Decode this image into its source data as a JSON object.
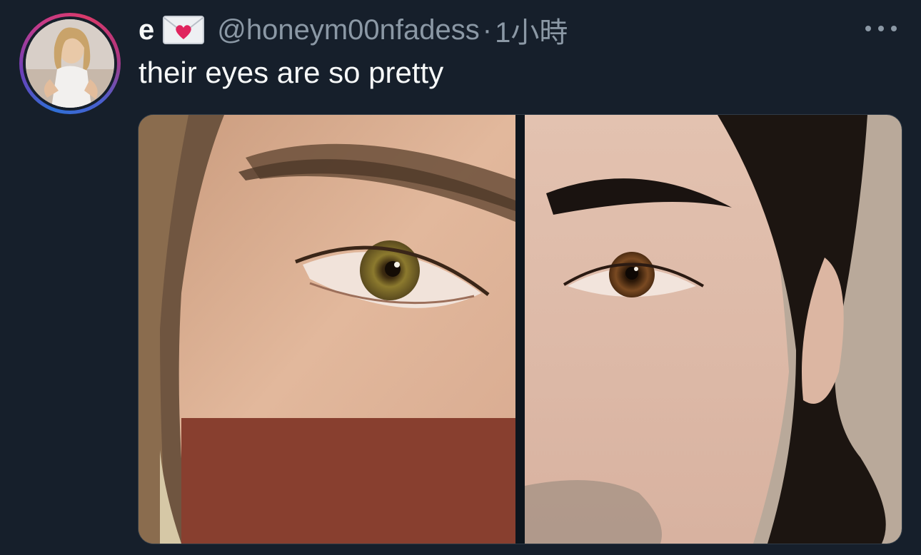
{
  "tweet": {
    "display_name": "e",
    "handle": "@honeym00nfadess",
    "separator": "·",
    "timestamp": "1小時",
    "text": "their eyes are so pretty"
  },
  "icons": {
    "name_emoji": "love-letter-icon",
    "more": "more-horizontal-icon"
  },
  "media": {
    "count": 2
  },
  "colors": {
    "background": "#161f2b",
    "primary_text": "#f7f9f9",
    "secondary_text": "#8b98a5"
  }
}
